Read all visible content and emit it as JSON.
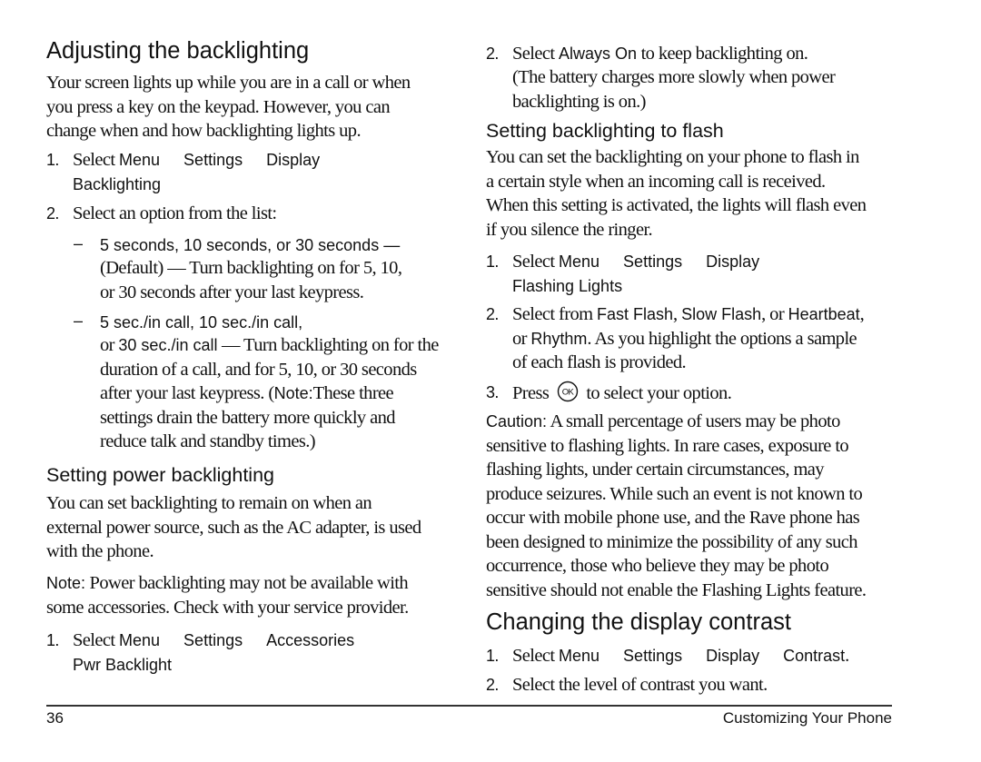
{
  "left": {
    "section1": {
      "heading": "Adjusting the backlighting",
      "intro": [
        "Your screen lights up while you are in a call or when",
        "you press a key on the keypad. However, you can",
        "change when and how backlighting lights up."
      ],
      "step1": {
        "num": "1.",
        "prefix": "Select ",
        "path": [
          "Menu",
          "Settings",
          "Display"
        ],
        "path_line2": "Backlighting"
      },
      "step2": {
        "num": "2.",
        "text": "Select an option from the list:"
      },
      "option1": {
        "dash": "–",
        "label": "5 seconds, 10 seconds, or 30 seconds",
        "label_suffix": " —",
        "lines": [
          "(Default) — Turn backlighting on for 5, 10,",
          "or 30 seconds after your last keypress."
        ]
      },
      "option2": {
        "dash": "–",
        "label_line1": "5 sec./in call, 10 sec./in call,",
        "label_line2_prefix": "or ",
        "label_line2_ui": "30 sec./in call",
        "line2_rest": " — Turn backlighting on for the",
        "lines": [
          "duration of a call, and for 5, 10, or 30 seconds",
          "after your last keypress. (",
          "settings drain the battery more quickly and",
          "reduce talk and standby times.)"
        ],
        "note_label": "Note:",
        "note_rest": "These three"
      }
    },
    "section2": {
      "heading": "Setting power backlighting",
      "intro": [
        "You can set backlighting to remain on when an",
        "external power source, such as the AC adapter, is used",
        "with the phone."
      ],
      "note_label": "Note:",
      "note_lines": [
        " Power backlighting may not be available with",
        "some accessories. Check with your service provider."
      ],
      "step1": {
        "num": "1.",
        "prefix": "Select ",
        "path": [
          "Menu",
          "Settings",
          "Accessories"
        ],
        "path_line2": "Pwr Backlight"
      }
    }
  },
  "right": {
    "section2_cont": {
      "step2": {
        "num": "2.",
        "prefix": "Select ",
        "ui": "Always On",
        "rest": " to keep backlighting on.",
        "lines": [
          "(The battery charges more slowly when power",
          "backlighting is on.)"
        ]
      }
    },
    "section3": {
      "heading": "Setting backlighting to flash",
      "intro": [
        "You can set the backlighting on your phone to flash in",
        "a certain style when an incoming call is received.",
        "When this setting is activated, the lights will flash even",
        "if you silence the ringer."
      ],
      "step1": {
        "num": "1.",
        "prefix": "Select ",
        "path": [
          "Menu",
          "Settings",
          "Display"
        ],
        "path_line2": "Flashing Lights"
      },
      "step2": {
        "num": "2.",
        "prefix": "Select from ",
        "opt1": "Fast Flash",
        "sep1": ", ",
        "opt2": "Slow Flash",
        "sep2": ", or ",
        "opt3": "Heartbeat",
        "sep3": ",",
        "line2_prefix": "or ",
        "opt4": "Rhythm",
        "line2_rest": ". As you highlight the options a sample",
        "line3": "of each flash is provided."
      },
      "step3": {
        "num": "3.",
        "prefix": "Press ",
        "icon_label": "OK",
        "rest": " to select your option."
      },
      "caution_label": "Caution:",
      "caution_lines": [
        " A small percentage of users may be photo",
        "sensitive to flashing lights. In rare cases, exposure to",
        "flashing lights, under certain circumstances, may",
        "produce seizures. While such an event is not known to",
        "occur with mobile phone use, and the Rave phone has",
        "been designed to minimize the possibility of any such",
        "occurrence, those who believe they may be photo",
        "sensitive should not enable the Flashing Lights feature."
      ]
    },
    "section4": {
      "heading": "Changing the display contrast",
      "step1": {
        "num": "1.",
        "prefix": "Select ",
        "path": [
          "Menu",
          "Settings",
          "Display",
          "Contrast"
        ],
        "suffix": "."
      },
      "step2": {
        "num": "2.",
        "text": "Select the level of contrast you want."
      }
    }
  },
  "footer": {
    "page_number": "36",
    "chapter_title": "Customizing Your Phone"
  }
}
